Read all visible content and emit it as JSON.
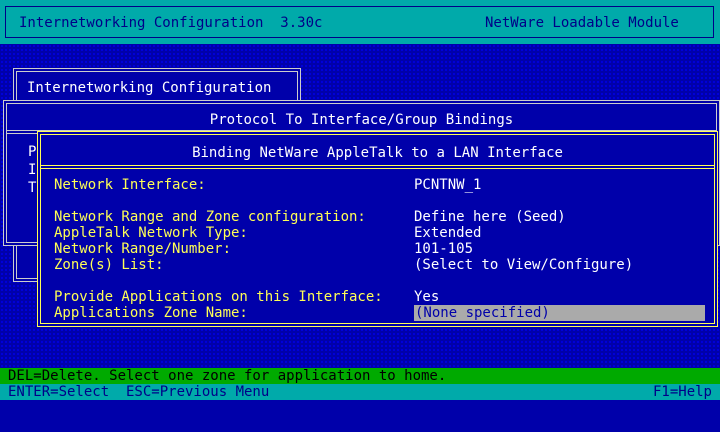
{
  "header": {
    "title": "Internetworking Configuration  3.30c",
    "module": "NetWare Loadable Module"
  },
  "window_main": {
    "title": "Internetworking Configuration"
  },
  "window_bindings": {
    "title": "Protocol To Interface/Group Bindings",
    "partial_left": [
      "P",
      "I",
      "T"
    ]
  },
  "window_binding": {
    "title": "Binding NetWare AppleTalk to a LAN Interface",
    "fields": [
      {
        "label": "Network Interface:",
        "value": "PCNTNW_1"
      },
      {
        "label": "Network Range and Zone configuration:",
        "value": "Define here (Seed)"
      },
      {
        "label": "AppleTalk Network Type:",
        "value": "Extended"
      },
      {
        "label": "Network Range/Number:",
        "value": "101-105"
      },
      {
        "label": "Zone(s) List:",
        "value": "(Select to View/Configure)"
      },
      {
        "label": "Provide Applications on this Interface:",
        "value": "Yes"
      },
      {
        "label": "Applications Zone Name:",
        "value": "(None specified)"
      }
    ]
  },
  "status": {
    "line1": "DEL=Delete. Select one zone for application to home.",
    "line2_left": "ENTER=Select  ESC=Previous Menu",
    "line2_right": "F1=Help"
  },
  "colors": {
    "background": "#0000aa",
    "header": "#00aaaa",
    "label": "#ffff55",
    "value": "#ffffff",
    "selected_bg": "#aaaaaa",
    "status_green": "#00aa00"
  }
}
